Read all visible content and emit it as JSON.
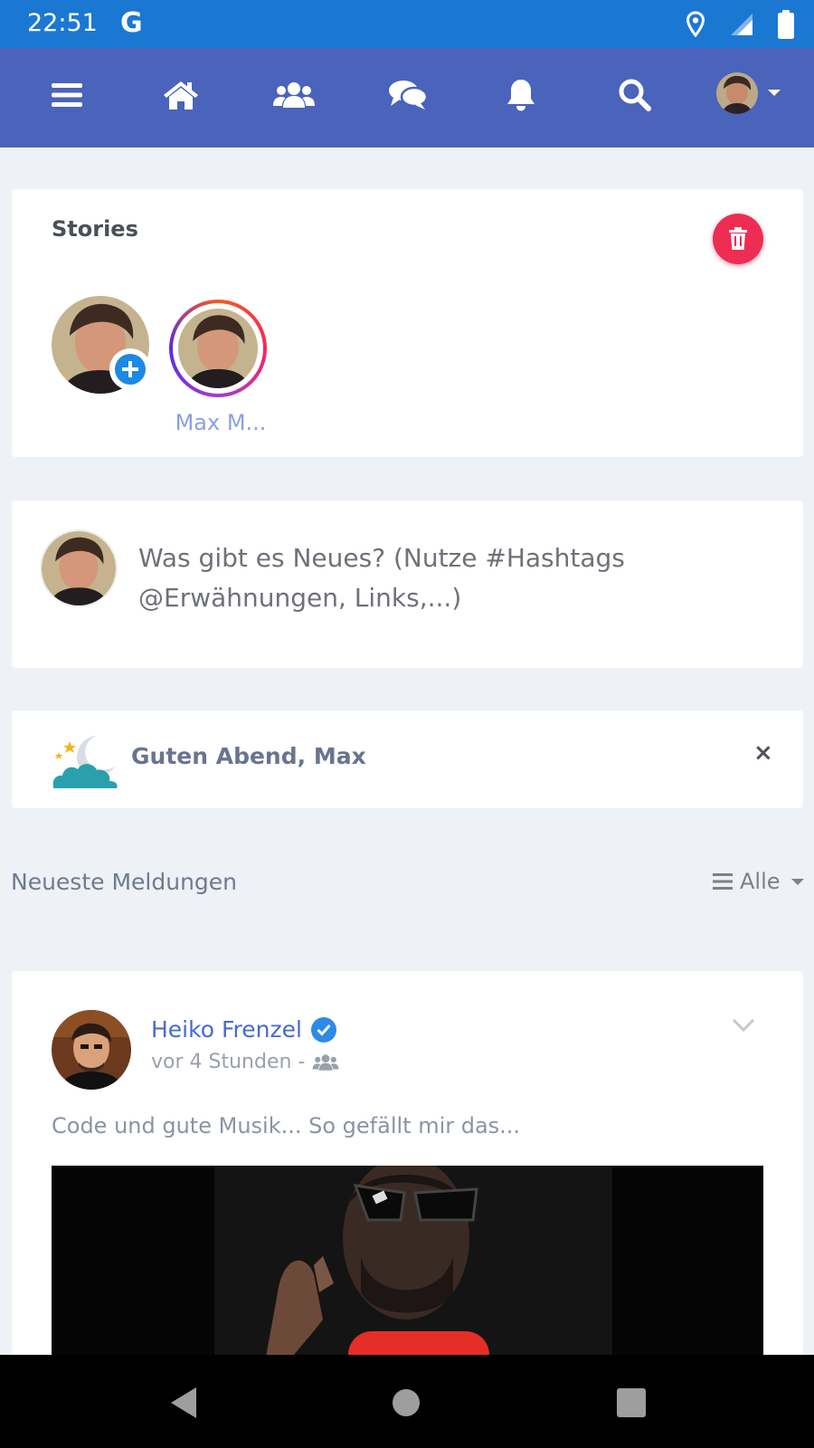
{
  "status_bar": {
    "time": "22:51",
    "google_logo": "G",
    "icons": [
      "location-icon",
      "signal-icon",
      "battery-icon"
    ]
  },
  "top_nav": {
    "items": [
      "menu-icon",
      "home-icon",
      "groups-icon",
      "messages-icon",
      "notifications-icon",
      "search-icon"
    ],
    "accent": "#4a63bb"
  },
  "stories": {
    "title": "Stories",
    "items": [
      {
        "name": "Max M..."
      }
    ]
  },
  "composer": {
    "placeholder": "Was gibt es Neues? (Nutze #Hashtags @Erwähnungen, Links,...)"
  },
  "greeting": {
    "text": "Guten Abend, Max",
    "close": "×"
  },
  "feed": {
    "title": "Neueste Meldungen",
    "filter": "Alle"
  },
  "post": {
    "author": "Heiko Frenzel",
    "meta": "vor 4 Stunden -",
    "text": "Code und gute Musik... So gefällt mir das..."
  },
  "colors": {
    "status_bar": "#1a78d2",
    "delete": "#ee2d53",
    "link": "#4769d6"
  }
}
